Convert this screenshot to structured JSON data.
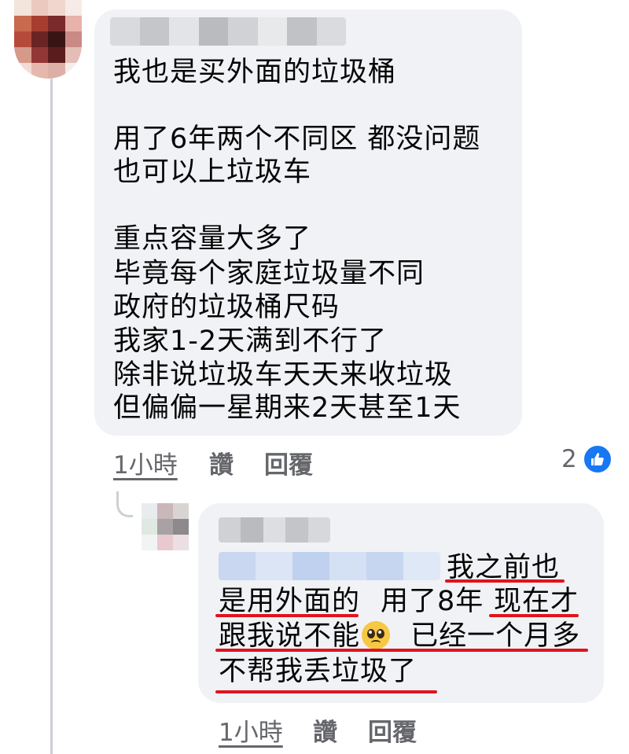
{
  "comment": {
    "lines": [
      "我也是买外面的垃圾桶",
      "用了6年两个不同区 都没问题",
      "也可以上垃圾车",
      "重点容量大多了",
      "毕竟每个家庭垃圾量不同",
      "政府的垃圾桶尺码",
      "我家1-2天满到不行了",
      "除非说垃圾车天天来收垃圾",
      "但偏偏一星期来2天甚至1天"
    ],
    "time": "1小時",
    "like_label": "讚",
    "reply_label": "回覆",
    "like_count": "2",
    "like_icon": "thumbs-up-icon"
  },
  "reply": {
    "line1": "我之前也",
    "line2a": "是用外面的",
    "line2b": "用了8年",
    "line2c": "现在才",
    "line3a": "跟我说不能",
    "line3b": "已经一个月多",
    "line4": "不帮我丢垃圾了",
    "emoji": "pleading-face-emoji",
    "time": "1小時",
    "like_label": "讚",
    "reply_label": "回覆"
  },
  "colors": {
    "bubble": "#f0f2f5",
    "meta_text": "#65676b",
    "like_blue": "#1877f2",
    "underline_red": "#e0141e"
  }
}
